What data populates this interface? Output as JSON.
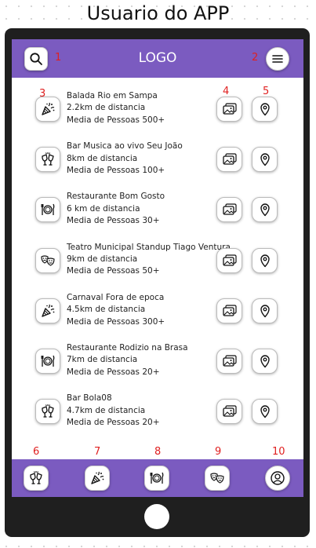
{
  "page_title": "Usuario do APP",
  "header": {
    "logo": "LOGO",
    "search_icon": "search-icon",
    "menu_icon": "hamburger-menu-icon",
    "accent_color": "#7b5bc0"
  },
  "markers": {
    "m1": "1",
    "m2": "2",
    "m3": "3",
    "m4": "4",
    "m5": "5",
    "m6": "6",
    "m7": "7",
    "m8": "8",
    "m9": "9",
    "m10": "10",
    "color": "#e02020"
  },
  "venues": [
    {
      "name": "Balada Rio em Sampa",
      "distance": "2.2km de distancia",
      "people": "Media de Pessoas 500+",
      "icon": "party-popper-icon"
    },
    {
      "name": "Bar Musica ao vivo Seu João",
      "distance": "8km de distancia",
      "people": "Media de Pessoas 100+",
      "icon": "cheers-glasses-icon"
    },
    {
      "name": "Restaurante Bom Gosto",
      "distance": "6 km de distancia",
      "people": "Media de Pessoas 30+",
      "icon": "plate-cutlery-icon"
    },
    {
      "name": "Teatro Municipal Standup Tiago Ventura",
      "distance": "9km de distancia",
      "people": "Media de Pessoas 50+",
      "icon": "theater-masks-icon"
    },
    {
      "name": "Carnaval Fora de epoca",
      "distance": "4.5km de distancia",
      "people": "Media de Pessoas 300+",
      "icon": "party-popper-icon"
    },
    {
      "name": "Restaurante Rodizio na Brasa",
      "distance": "7km de distancia",
      "people": "Media de Pessoas 20+",
      "icon": "plate-cutlery-icon"
    },
    {
      "name": "Bar Bola08",
      "distance": "4.7km de distancia",
      "people": "Media de Pessoas 20+",
      "icon": "cheers-glasses-icon"
    }
  ],
  "row_actions": {
    "photos_icon": "photos-icon",
    "location_icon": "location-pin-icon"
  },
  "bottom_nav": [
    {
      "icon": "cheers-glasses-icon"
    },
    {
      "icon": "party-popper-icon"
    },
    {
      "icon": "plate-cutlery-icon"
    },
    {
      "icon": "theater-masks-icon"
    },
    {
      "icon": "user-profile-icon"
    }
  ]
}
